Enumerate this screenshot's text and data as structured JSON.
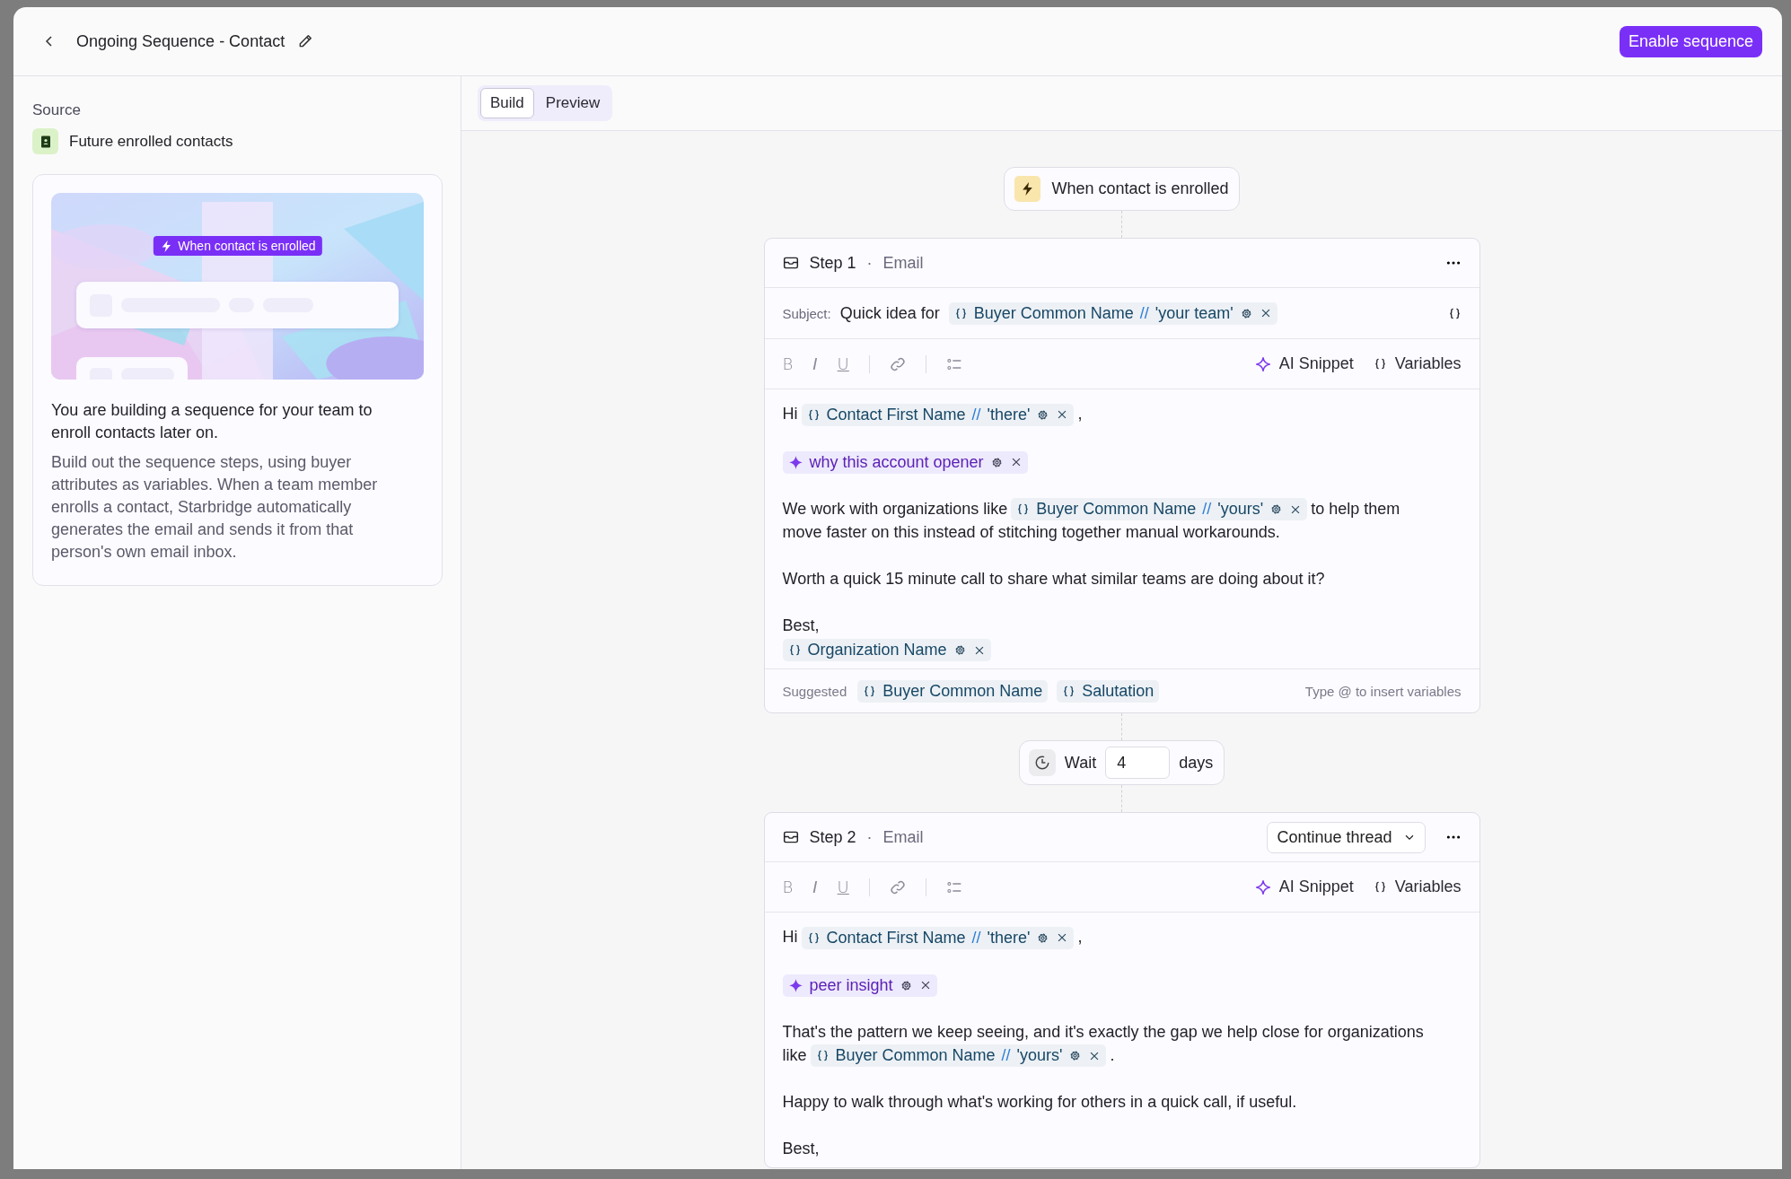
{
  "header": {
    "title": "Ongoing Sequence - Contact",
    "action": "Enable sequence"
  },
  "sidebar": {
    "section_label": "Source",
    "source": "Future enrolled contacts",
    "info_card": {
      "illustration_badge": "When contact is enrolled",
      "heading": "You are building a sequence for your team to enroll contacts later on.",
      "body": "Build out the sequence steps, using buyer attributes as variables. When a team member enrolls a contact, Starbridge automatically generates the email and sends it from that person's own email inbox."
    }
  },
  "tabs": [
    {
      "label": "Build",
      "selected": true
    },
    {
      "label": "Preview",
      "selected": false
    }
  ],
  "flow": [
    {
      "kind": "trigger",
      "label": "When contact is enrolled"
    },
    {
      "kind": "step",
      "title": "Step 1",
      "dot": "·",
      "channel": "Email",
      "subject": {
        "label": "Subject:",
        "parts": [
          {
            "kind": "text",
            "text": "Quick idea for"
          },
          {
            "kind": "variable",
            "name": "Buyer Common Name",
            "separator": "//",
            "fallback": "'your team'"
          }
        ]
      },
      "toolbar": {
        "format": [
          {
            "kind": "bold",
            "label": "B"
          },
          {
            "kind": "italic",
            "label": "I"
          },
          {
            "kind": "underline",
            "label": "U"
          }
        ],
        "ai_label": "AI Snippet",
        "variables_label": "Variables"
      },
      "paragraphs": [
        [
          {
            "kind": "text",
            "text": "Hi"
          },
          {
            "kind": "variable",
            "name": "Contact First Name",
            "separator": "//",
            "fallback": "'there'"
          },
          {
            "kind": "text",
            "text": ","
          }
        ],
        [
          {
            "kind": "ai",
            "name": "why this account opener"
          }
        ],
        [
          {
            "kind": "text",
            "text": "We work with organizations like"
          },
          {
            "kind": "variable",
            "name": "Buyer Common Name",
            "separator": "//",
            "fallback": "'yours'"
          },
          {
            "kind": "text",
            "text": "to help them"
          },
          {
            "kind": "break"
          },
          {
            "kind": "text",
            "text": "move faster on this instead of stitching together manual workarounds."
          }
        ],
        [
          {
            "kind": "text",
            "text": "Worth a quick 15 minute call to share what similar teams are doing about it?"
          }
        ],
        [
          {
            "kind": "text",
            "text": "Best,"
          },
          {
            "kind": "break"
          },
          {
            "kind": "variable",
            "name": "Organization Name"
          }
        ]
      ],
      "suggestions": {
        "label": "Suggested",
        "chips": [
          "Buyer Common Name",
          "Salutation"
        ],
        "hint": "Type @ to insert variables"
      }
    },
    {
      "kind": "wait",
      "label": "Wait",
      "value": "4",
      "unit": "days"
    },
    {
      "kind": "step",
      "title": "Step 2",
      "dot": "·",
      "channel": "Email",
      "thread_option": "Continue thread",
      "toolbar": {
        "format": [
          {
            "kind": "bold",
            "label": "B"
          },
          {
            "kind": "italic",
            "label": "I"
          },
          {
            "kind": "underline",
            "label": "U"
          }
        ],
        "ai_label": "AI Snippet",
        "variables_label": "Variables"
      },
      "paragraphs": [
        [
          {
            "kind": "text",
            "text": "Hi"
          },
          {
            "kind": "variable",
            "name": "Contact First Name",
            "separator": "//",
            "fallback": "'there'"
          },
          {
            "kind": "text",
            "text": ","
          }
        ],
        [
          {
            "kind": "ai",
            "name": "peer insight"
          }
        ],
        [
          {
            "kind": "text",
            "text": "That's the pattern we keep seeing, and it's exactly the gap we help close for organizations"
          },
          {
            "kind": "break"
          },
          {
            "kind": "text",
            "text": "like"
          },
          {
            "kind": "variable",
            "name": "Buyer Common Name",
            "separator": "//",
            "fallback": "'yours'"
          },
          {
            "kind": "text",
            "text": "."
          }
        ],
        [
          {
            "kind": "text",
            "text": "Happy to walk through what's working for others in a quick call, if useful."
          }
        ],
        [
          {
            "kind": "text",
            "text": "Best,"
          }
        ]
      ]
    }
  ]
}
